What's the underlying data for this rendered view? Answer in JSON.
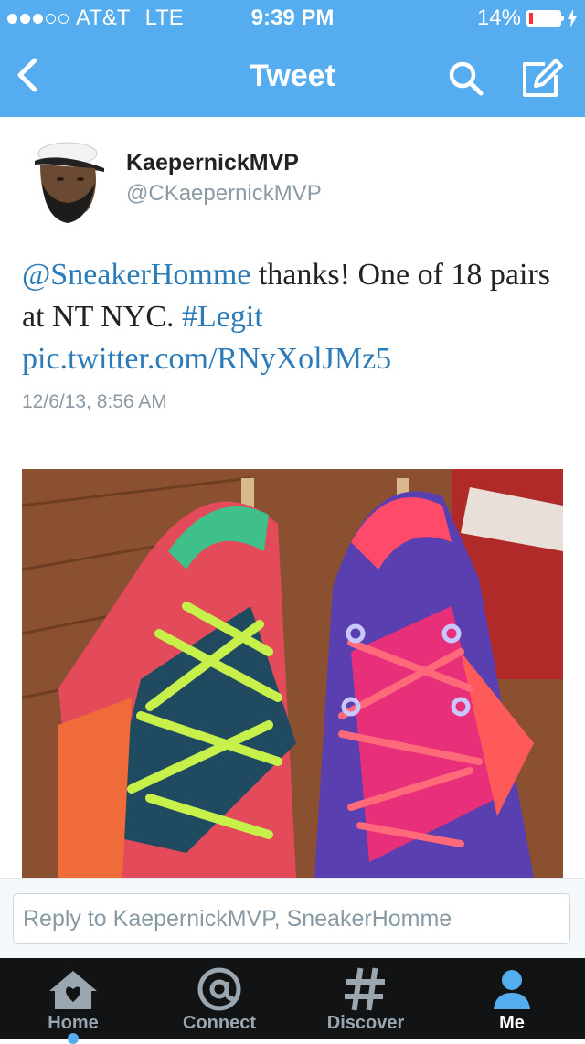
{
  "status_bar": {
    "carrier": "AT&T",
    "network": "LTE",
    "time": "9:39 PM",
    "battery": "14%",
    "battery_level": 0.14
  },
  "nav": {
    "title": "Tweet"
  },
  "tweet": {
    "author_name": "KaepernickMVP",
    "author_handle": "@CKaepernickMVP",
    "mention": "@SneakerHomme",
    "text_part1": " thanks! One of 18 pairs at NT NYC. ",
    "hashtag": "#Legit",
    "link": "pic.twitter.com/RNyXolJMz5",
    "timestamp": "12/6/13, 8:56 AM"
  },
  "reply": {
    "placeholder": "Reply to KaepernickMVP, SneakerHomme"
  },
  "tabs": [
    {
      "label": "Home",
      "icon": "home-icon"
    },
    {
      "label": "Connect",
      "icon": "at-icon"
    },
    {
      "label": "Discover",
      "icon": "hash-icon"
    },
    {
      "label": "Me",
      "icon": "person-icon"
    }
  ],
  "colors": {
    "brand": "#55acee",
    "link": "#2b7bb9",
    "tab_bar": "#111315"
  }
}
